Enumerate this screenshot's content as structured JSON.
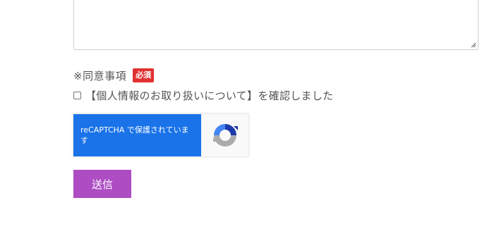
{
  "form": {
    "consent": {
      "label": "※同意事項",
      "required_badge": "必須",
      "checkbox_text": "【個人情報のお取り扱いについて】を確認しました",
      "checked": false
    },
    "recaptcha": {
      "text": "reCAPTCHA で保護されています",
      "icon": "recaptcha-logo-icon",
      "brand_color": "#1a73e8"
    },
    "submit_label": "送信"
  },
  "colors": {
    "required_badge": "#e03131",
    "submit_button": "#ad4cc3",
    "text": "#555555"
  }
}
